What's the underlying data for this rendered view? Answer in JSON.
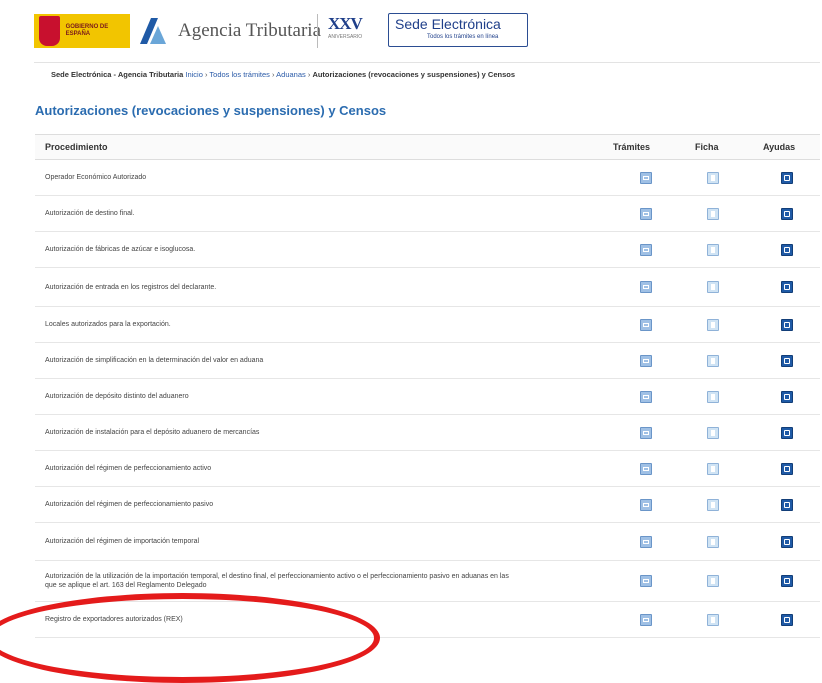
{
  "header": {
    "gov_logo_text": "GOBIERNO DE ESPAÑA",
    "agency_name": "Agencia Tributaria",
    "anniversary": {
      "numeral": "XXV",
      "label": "ANIVERSARIO"
    },
    "sede": {
      "title": "Sede Electrónica",
      "subtitle": "Todos los trámites en línea"
    }
  },
  "breadcrumb": {
    "site": "Sede Electrónica - Agencia Tributaria",
    "items": [
      "Inicio",
      "Todos los trámites",
      "Aduanas"
    ],
    "current": "Autorizaciones (revocaciones y suspensiones) y Censos"
  },
  "page_title": "Autorizaciones (revocaciones y suspensiones) y Censos",
  "table": {
    "columns": {
      "procedimiento": "Procedimiento",
      "tramites": "Trámites",
      "ficha": "Ficha",
      "ayudas": "Ayudas"
    },
    "rows": [
      {
        "label": "Operador Económico Autorizado"
      },
      {
        "label": "Autorización de destino final."
      },
      {
        "label": "Autorización de fábricas de azúcar e isoglucosa."
      },
      {
        "label": "Autorización de entrada en los registros del declarante."
      },
      {
        "label": "Locales autorizados para la exportación."
      },
      {
        "label": "Autorización de simplificación en la determinación del valor en aduana"
      },
      {
        "label": "Autorización de depósito distinto del aduanero"
      },
      {
        "label": "Autorización de instalación para el depósito aduanero de mercancías"
      },
      {
        "label": "Autorización del régimen de perfeccionamiento activo"
      },
      {
        "label": "Autorización del régimen de perfeccionamiento pasivo"
      },
      {
        "label": "Autorización del régimen de importación temporal"
      },
      {
        "label": "Autorización de la utilización de la importación temporal, el destino final, el perfeccionamiento activo o el perfeccionamiento pasivo en aduanas en las que se aplique el art. 163 del Reglamento Delegado"
      },
      {
        "label": "Registro de exportadores autorizados (REX)"
      }
    ]
  },
  "colors": {
    "title": "#2b6cb0",
    "annotation_circle": "#e41b1b",
    "icon_blue": "#1f5aa6"
  },
  "icons": {
    "tramites": "form-icon",
    "ficha": "document-icon",
    "ayudas": "help-icon"
  }
}
